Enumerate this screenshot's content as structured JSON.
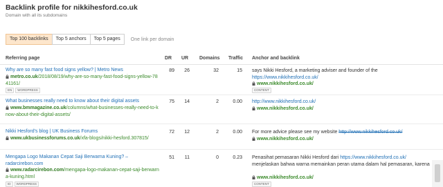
{
  "header": {
    "title": "Backlink profile for nikkihesford.co.uk",
    "subtitle": "Domain with all its subdomains"
  },
  "tabs": {
    "items": [
      {
        "label": "Top 100 backlinks",
        "active": true
      },
      {
        "label": "Top 5 anchors",
        "active": false
      },
      {
        "label": "Top 5 pages",
        "active": false
      }
    ],
    "note": "One link per domain"
  },
  "table": {
    "columns": {
      "referring": "Referring page",
      "dr": "DR",
      "ur": "UR",
      "domains": "Domains",
      "traffic": "Traffic",
      "anchor": "Anchor and backlink"
    },
    "rows": [
      {
        "title": "Why are so many fast food signs yellow? | Metro News",
        "url_domain": "metro.co.uk",
        "url_path": "/2018/08/19/why-are-so-many-fast-food-signs-yellow-7841161/",
        "tags": [
          "EN",
          "WORDPRESS"
        ],
        "dr": "89",
        "ur": "26",
        "domains": "32",
        "traffic": "15",
        "anchor_text": "says Nikki Hesford, a marketing adviser and founder of the",
        "anchor_link": "https://www.nikkihesford.co.uk/",
        "anchor_strike": "",
        "anchor_after": "",
        "target": "www.nikkihesford.co.uk/",
        "target_tag": "CONTENT"
      },
      {
        "title": "What businesses really need to know about their digital assets",
        "url_domain": "www.bmmagazine.co.uk",
        "url_path": "/columns/what-businesses-really-need-to-know-about-their-digital-assets/",
        "tags": [],
        "dr": "75",
        "ur": "14",
        "domains": "2",
        "traffic": "0.00",
        "anchor_text": "",
        "anchor_link": "http://www.nikkihesford.co.uk/",
        "anchor_strike": "",
        "anchor_after": "",
        "target": "www.nikkihesford.co.uk/",
        "target_tag": ""
      },
      {
        "title": "Nikki Hesford's blog | UK Business Forums",
        "url_domain": "www.ukbusinessforums.co.uk",
        "url_path": "/xfa-blogs/nikki-hesford.307815/",
        "tags": [],
        "dr": "72",
        "ur": "12",
        "domains": "2",
        "traffic": "0.00",
        "anchor_text": "For more advice please see my website",
        "anchor_link": "",
        "anchor_strike": "http://www.nikkihesford.co.uk/",
        "anchor_after": "",
        "target": "www.nikkihesford.co.uk/",
        "target_tag": ""
      },
      {
        "title": "Mengapa Logo Makanan Cepat Saji Berwarna Kuning? – radarcirebon.com",
        "url_domain": "www.radarcirebon.com",
        "url_path": "/mengapa-logo-makanan-cepat-saji-berwarna-kuning.html",
        "tags": [
          "ID",
          "WORDPRESS"
        ],
        "dr": "51",
        "ur": "11",
        "domains": "0",
        "traffic": "0.23",
        "anchor_text": "Penasihat pemasaran Nikki Hesford dari",
        "anchor_link": "https://www.nikkihesford.co.uk/",
        "anchor_strike": "",
        "anchor_after": "menjelaskan bahwa warna memainkan peran utama dalam hal pemasaran, karena",
        "target": "www.nikkihesford.co.uk/",
        "target_tag": "CONTENT"
      }
    ]
  },
  "icons": {
    "lock": "lock-icon"
  },
  "colors": {
    "active_tab_bg": "#fde6cc",
    "link": "#1f6fb5",
    "url_green": "#3a8a2a"
  }
}
